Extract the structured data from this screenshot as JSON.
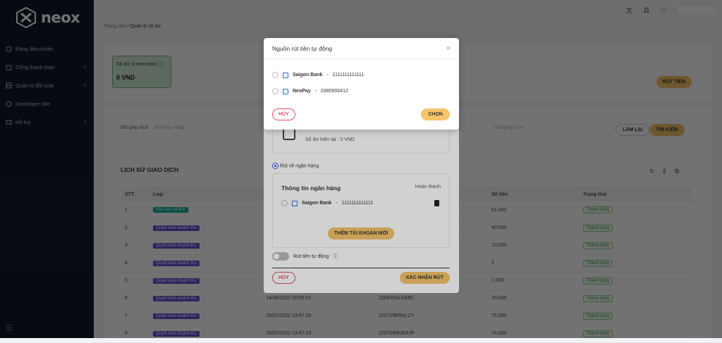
{
  "brand": {
    "logo_text": "neox"
  },
  "sidebar": {
    "items": [
      {
        "label": "Bảng điều khiển",
        "has_chevron": false
      },
      {
        "label": "Cổng thanh toán",
        "has_chevron": true
      },
      {
        "label": "Quản lý đối soát",
        "has_chevron": true
      },
      {
        "label": "Developer Site",
        "has_chevron": false
      },
      {
        "label": "Hỗ trợ",
        "has_chevron": true
      }
    ],
    "chevron": "∨"
  },
  "breadcrumb": {
    "home": "Trang chủ",
    "sep": "/",
    "current": "Quản lý số dư"
  },
  "balance_card": {
    "title": "Số dư ví merchant",
    "value": "0 VND"
  },
  "header_actions": {
    "withdraw": "RÚT TIỀN"
  },
  "filters": {
    "code_label": "Mã giao dịch",
    "code_placeholder": "Vui lòng nhập",
    "select_placeholder": "Vui lòng chọn",
    "reset": "LÀM LẠI",
    "search": "TÌM KIẾM"
  },
  "history": {
    "title": "LỊCH SỬ GIAO DỊCH",
    "columns": [
      "STT",
      "Loại",
      "",
      "",
      "Số tiền",
      "Trạng thái"
    ],
    "rows": [
      {
        "stt": "1",
        "type": "Yêu cầu rút tiền",
        "kind": "req",
        "date": "",
        "code": "",
        "amount": "51.002",
        "status": "Thành công"
      },
      {
        "stt": "2",
        "type": "Quyết toán doanh thu",
        "kind": "settle",
        "date": "",
        "code": "",
        "amount": "40.000",
        "status": "Thành công"
      },
      {
        "stt": "3",
        "type": "Quyết toán doanh thu",
        "kind": "settle",
        "date": "",
        "code": "",
        "amount": "10.000",
        "status": "Thành công"
      },
      {
        "stt": "4",
        "type": "Quyết toán doanh thu",
        "kind": "settle",
        "date": "",
        "code": "",
        "amount": "2",
        "status": "Thành công"
      },
      {
        "stt": "5",
        "type": "Quyết toán doanh thu",
        "kind": "settle",
        "date": "",
        "code": "",
        "amount": "1.000",
        "status": "Thành công"
      },
      {
        "stt": "6",
        "type": "Quyết toán doanh thu",
        "kind": "settle",
        "date": "14/08/2022 00:05:01",
        "code": "220815ALGMIC",
        "amount": "20.000",
        "status": "Thành công"
      },
      {
        "stt": "7",
        "type": "Quyết toán doanh thu",
        "kind": "settle",
        "date": "29/07/2022 13:47:28",
        "code": "220729ERKLZY",
        "amount": "75.000",
        "status": "Thành công"
      },
      {
        "stt": "8",
        "type": "Quyết toán doanh thu",
        "kind": "settle",
        "date": "29/07/2022 13:47:19",
        "code": "220729WJKFJP",
        "amount": "74.000",
        "status": "Thành công"
      }
    ]
  },
  "withdraw_modal": {
    "current_balance": "Số dư hiện tại :  0  VND",
    "bank_option": "Rút về ngân hàng",
    "bank_info_title": "Thông tin ngân hàng",
    "bank_info_status": "Hoàn thành",
    "bank_name": "Saigon Bank",
    "bank_account": "1111111111111",
    "add_account": "THÊM TÀI KHOẢN MỚI",
    "auto_withdraw": "Rút tiền tự động",
    "cancel": "HỦY",
    "confirm": "XÁC NHẬN RÚT"
  },
  "source_modal": {
    "title": "Nguồn rút tiền tự động",
    "close": "×",
    "options": [
      {
        "name": "Saigon Bank",
        "sep": "-",
        "value": "1111111111111"
      },
      {
        "name": "NeoPay",
        "sep": "-",
        "value": "0385900412"
      }
    ],
    "cancel": "HỦY",
    "choose": "CHỌN"
  },
  "colors": {
    "sidebar_bg": "#0f1b2d",
    "accent": "#f6c46b",
    "danger": "#e05260",
    "success": "#3a9b40"
  }
}
